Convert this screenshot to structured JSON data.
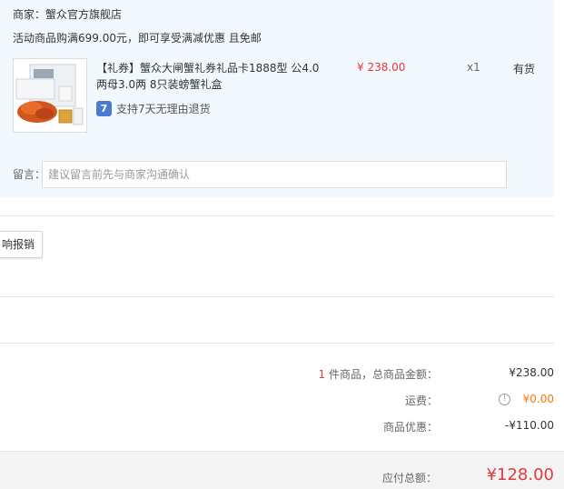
{
  "merchant": {
    "text": "商家：蟹众官方旗舰店"
  },
  "promo": {
    "text": "活动商品购满699.00元，即可享受满减优惠 且免邮"
  },
  "product": {
    "title": "【礼券】蟹众大闸蟹礼券礼品卡1888型 公4.0两母3.0两 8只装螃蟹礼盒",
    "return_icon": "7",
    "return_policy": "支持7天无理由退货",
    "price": "¥ 238.00",
    "quantity": "x1",
    "stock": "有货",
    "image_icon": "crab-gift-box-image"
  },
  "remark": {
    "label": "留言：",
    "placeholder": "建议留言前先与商家沟通确认"
  },
  "invoice": {
    "button_label": "响报销"
  },
  "summary": {
    "count_num": "1",
    "count_suffix": " 件商品，总商品金额：",
    "goods_total": "¥238.00",
    "shipping_label": "运费：",
    "shipping_info_icon": "!",
    "shipping_value": "¥0.00",
    "discount_label": "商品优惠：",
    "discount_value": "-¥110.00",
    "payable_label": "应付总额：",
    "payable_value": "¥128.00"
  },
  "colors": {
    "price_red": "#e4393c",
    "shipping_orange": "#ff7700",
    "panel_bg": "#f2f9fe",
    "badge_blue": "#4a7bd0"
  }
}
